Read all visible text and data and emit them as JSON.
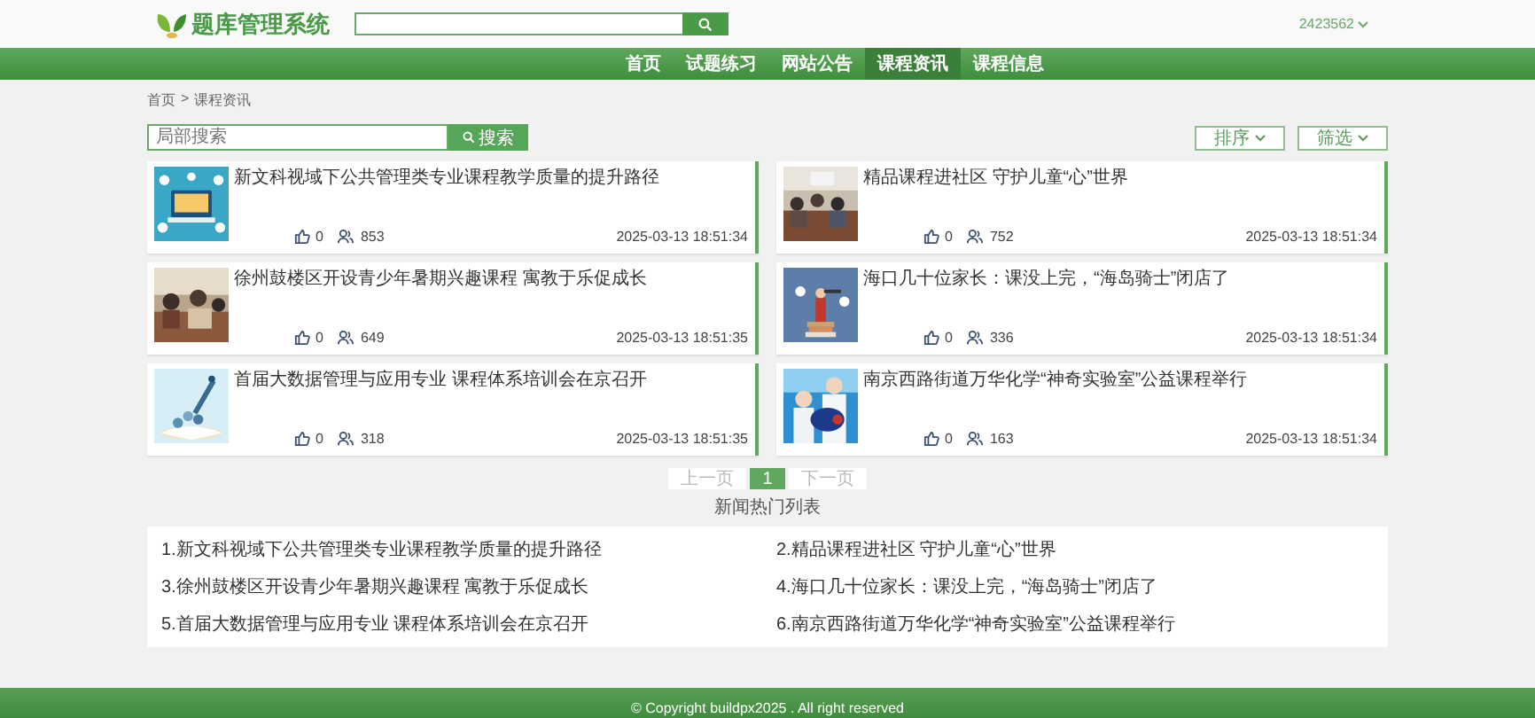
{
  "header": {
    "logo_text": "题库管理系统",
    "user": "2423562"
  },
  "nav": [
    {
      "label": "首页",
      "selected": false
    },
    {
      "label": "试题练习",
      "selected": false
    },
    {
      "label": "网站公告",
      "selected": false
    },
    {
      "label": "课程资讯",
      "selected": true
    },
    {
      "label": "课程信息",
      "selected": false
    }
  ],
  "breadcrumb": {
    "separator": ">",
    "items": [
      "首页",
      "课程资讯"
    ]
  },
  "toolbar": {
    "search": {
      "placeholder": "局部搜索"
    },
    "search_button": "搜索",
    "sort_button": "排序",
    "filter_button": "筛选"
  },
  "cards": [
    {
      "title": "新文科视域下公共管理类专业课程教学质量的提升路径",
      "likes": "0",
      "views": "853",
      "date": "2025-03-13 18:51:34"
    },
    {
      "title": "精品课程进社区 守护儿童“心”世界",
      "likes": "0",
      "views": "752",
      "date": "2025-03-13 18:51:34"
    },
    {
      "title": "徐州鼓楼区开设青少年暑期兴趣课程 寓教于乐促成长",
      "likes": "0",
      "views": "649",
      "date": "2025-03-13 18:51:35"
    },
    {
      "title": "海口几十位家长：课没上完，“海岛骑士”闭店了",
      "likes": "0",
      "views": "336",
      "date": "2025-03-13 18:51:34"
    },
    {
      "title": "首届大数据管理与应用专业 课程体系培训会在京召开",
      "likes": "0",
      "views": "318",
      "date": "2025-03-13 18:51:35"
    },
    {
      "title": "南京西路街道万华化学“神奇实验室”公益课程举行",
      "likes": "0",
      "views": "163",
      "date": "2025-03-13 18:51:34"
    }
  ],
  "pagination": [
    {
      "label": "上一页",
      "selected": false,
      "disabled": true
    },
    {
      "label": "1",
      "selected": true,
      "disabled": false
    },
    {
      "label": "下一页",
      "selected": false,
      "disabled": true
    }
  ],
  "hot_list": {
    "title": "新闻热门列表",
    "items": [
      "1.新文科视域下公共管理类专业课程教学质量的提升路径",
      "2.精品课程进社区 守护儿童“心”世界",
      "3.徐州鼓楼区开设青少年暑期兴趣课程 寓教于乐促成长",
      "4.海口几十位家长：课没上完，“海岛骑士”闭店了",
      "5.首届大数据管理与应用专业 课程体系培训会在京召开",
      "6.南京西路街道万华化学“神奇实验室”公益课程举行"
    ]
  },
  "footer": {
    "copyright": "© Copyright buildpx2025 . All right reserved"
  }
}
